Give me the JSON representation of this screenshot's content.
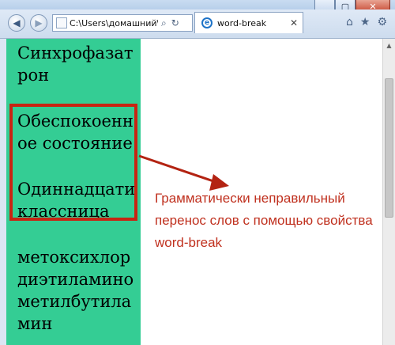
{
  "window": {
    "minimize_icon": "minimize-icon",
    "maximize_icon": "maximize-icon",
    "close_icon": "close-icon"
  },
  "toolbar": {
    "address": "C:\\Users\\домашний\\D",
    "tab_title": "word-break"
  },
  "content": {
    "words": [
      "Синхрофазатрон",
      "Обеспокоенное состояние",
      "Одиннадцатиклассница",
      "метоксихлордиэтиламинометилбутиламин"
    ],
    "annotation": "Грамматически неправильный перенос слов с помощью свойства word-break",
    "colors": {
      "column_bg": "#34cd94",
      "highlight_border": "#c82412",
      "annotation_text": "#c0311f"
    }
  }
}
